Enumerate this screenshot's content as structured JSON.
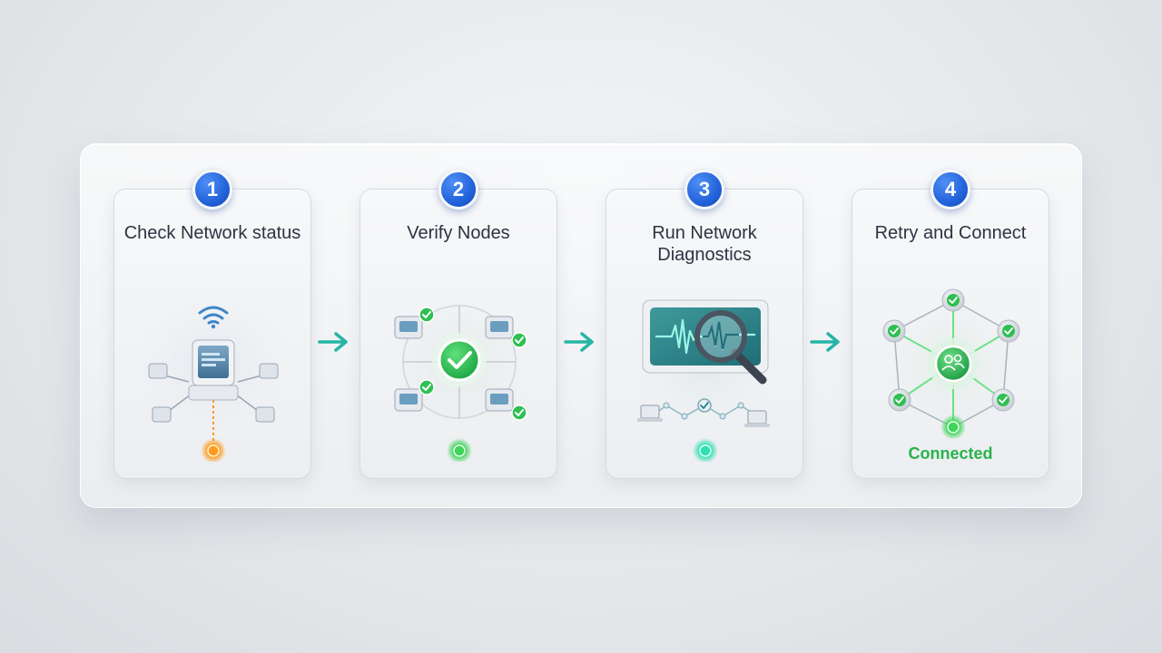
{
  "steps": [
    {
      "number": "1",
      "title": "Check Network status",
      "status_color": "#ff9a1f"
    },
    {
      "number": "2",
      "title": "Verify Nodes",
      "status_color": "#3fd45a"
    },
    {
      "number": "3",
      "title": "Run Network Diagnostics",
      "status_color": "#2fe0b0"
    },
    {
      "number": "4",
      "title": "Retry and Connect",
      "status_text": "Connected",
      "status_color": "#3fd45a"
    }
  ],
  "colors": {
    "badge": "#1f5fd8",
    "arrow": "#26b5a6",
    "connected_text": "#28b34a"
  },
  "icons": {
    "step1": [
      "wifi-icon",
      "computer-monitor-icon",
      "network-node-icon"
    ],
    "step2": [
      "checkmark-icon",
      "server-node-icon"
    ],
    "step3": [
      "waveform-monitor-icon",
      "magnifying-glass-icon",
      "laptop-icon"
    ],
    "step4": [
      "user-group-icon",
      "checkmark-node-icon"
    ]
  }
}
